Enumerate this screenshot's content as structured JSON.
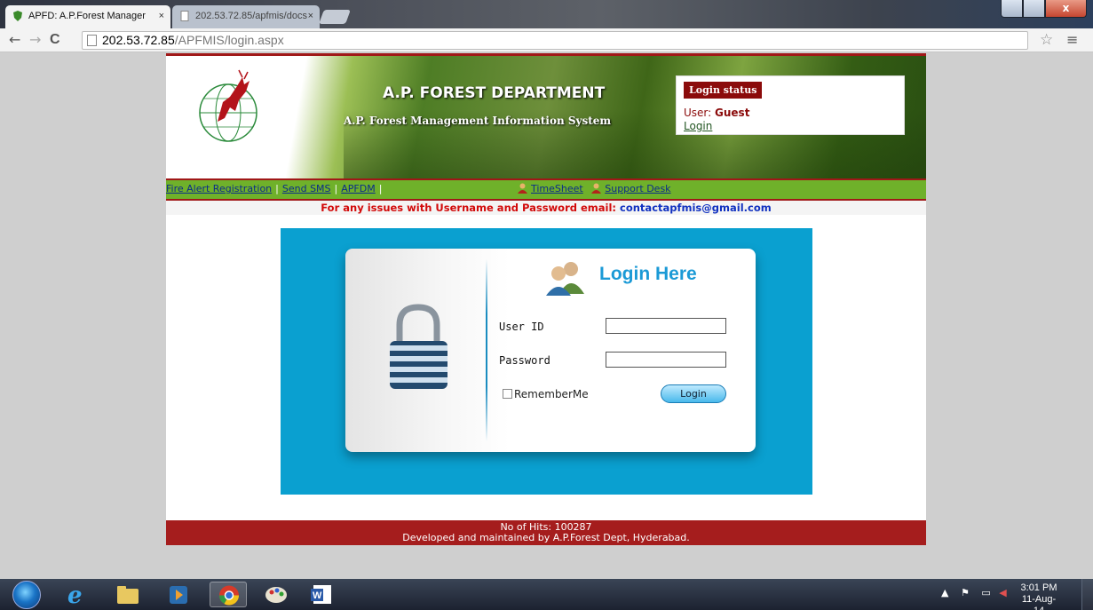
{
  "browser": {
    "tabs": [
      {
        "label": "APFD: A.P.Forest Manager",
        "active": true
      },
      {
        "label": "202.53.72.85/apfmis/docs",
        "active": false
      }
    ],
    "url_host": "202.53.72.85",
    "url_path": "/APFMIS/login.aspx",
    "close_glyph": "×",
    "nav": {
      "back": "←",
      "forward": "→",
      "reload": "C",
      "star": "☆",
      "menu": "≡"
    },
    "window_close": "x"
  },
  "header": {
    "dept_title": "A.P. FOREST DEPARTMENT",
    "system_title": "A.P. Forest Management Information System",
    "status_heading": "Login status",
    "user_label": "User:",
    "user_value": "Guest",
    "login_link": "Login"
  },
  "linkbar": {
    "fire_alert": "Fire Alert Registration",
    "send_sms": "Send SMS",
    "apfdm": "APFDM",
    "timesheet": "TimeSheet",
    "support": "Support Desk"
  },
  "notice": {
    "text": "For any issues with Username and Password email:",
    "email": "contactapfmis@gmail.com"
  },
  "login": {
    "title": "Login Here",
    "user_id_label": "User ID",
    "password_label": "Password",
    "remember_label": "RememberMe",
    "button_label": "Login",
    "user_id_value": "",
    "password_value": ""
  },
  "footer": {
    "hits": "No of Hits: 100287",
    "credit": "Developed and maintained by A.P.Forest Dept, Hyderabad."
  },
  "taskbar": {
    "time": "3:01 PM",
    "date": "11-Aug-14",
    "apps": [
      "start-orb",
      "internet-explorer-icon",
      "file-explorer-icon",
      "media-player-icon",
      "chrome-icon",
      "paint-icon",
      "word-icon"
    ]
  },
  "colors": {
    "brand_red": "#a51d1d",
    "link_green": "#6fb12a",
    "panel_blue": "#0aa0d0",
    "title_blue": "#1b9ad6"
  }
}
